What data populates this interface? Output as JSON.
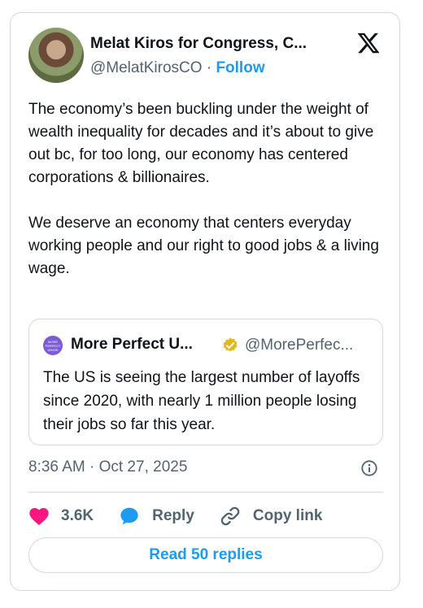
{
  "tweet": {
    "author_name": "Melat Kiros for Congress, C...",
    "author_handle": "@MelatKirosCO",
    "separator": "·",
    "follow_label": "Follow",
    "paragraph_1": "The economy’s been buckling under the weight of wealth inequality for decades and it’s about to give out bc, for too long, our economy has centered corporations & billionaires.",
    "paragraph_2": "We deserve an economy that centers everyday working people and our right to good jobs & a living wage.",
    "timestamp": "8:36 AM · Oct 27, 2025",
    "like_count": "3.6K",
    "reply_label": "Reply",
    "copy_link_label": "Copy link",
    "read_replies_label": "Read 50 replies"
  },
  "quote": {
    "avatar_text": "MORE PERFECT UNION",
    "author_name": "More Perfect U...",
    "author_handle": "@MorePerfec...",
    "text": "The US is seeing the largest number of layoffs since 2020, with nearly 1 million people losing their jobs so far this year."
  },
  "icons": {
    "platform": "x-logo-icon",
    "verified": "verified-badge-icon",
    "info": "info-icon",
    "like": "heart-icon",
    "reply": "reply-bubble-icon",
    "copy_link": "link-icon"
  },
  "colors": {
    "accent": "#1d9bf0",
    "like": "#f91880",
    "verified_gold": "#e2b719",
    "muted_text": "#536471",
    "border": "#cfd9de"
  }
}
